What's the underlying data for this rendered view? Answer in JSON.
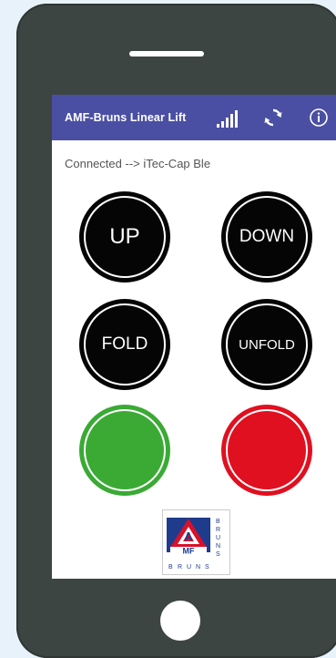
{
  "app": {
    "title": "AMF-Bruns Linear Lift",
    "status_text": "Connected --> iTec-Cap Ble",
    "bar_color": "#4a4fa3"
  },
  "toolbar": {
    "signal_icon": "signal-strength-icon",
    "refresh_icon": "sync-icon",
    "info_icon": "info-icon"
  },
  "controls": {
    "up_label": "UP",
    "down_label": "DOWN",
    "fold_label": "FOLD",
    "unfold_label": "UNFOLD",
    "green_color": "#3aaa35",
    "red_color": "#e01020"
  },
  "logo": {
    "text_amf": "AMF",
    "text_bruns": "BRUNS"
  }
}
